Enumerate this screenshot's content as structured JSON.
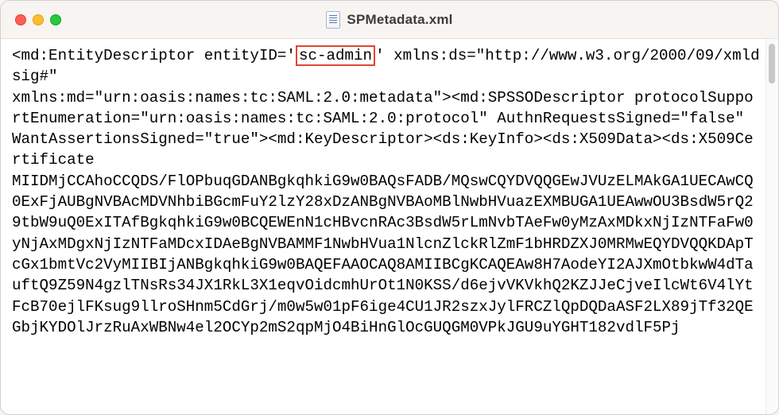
{
  "window": {
    "title": "SPMetadata.xml"
  },
  "highlight": {
    "entity_id": "sc-admin"
  },
  "xml": {
    "pre": "<md:EntityDescriptor entityID='",
    "post_entity": "' xmlns:ds=\"http://www.w3.org/2000/09/xmldsig#\"\nxmlns:md=\"urn:oasis:names:tc:SAML:2.0:metadata\"><md:SPSSODescriptor protocolSupportEnumeration=\"urn:oasis:names:tc:SAML:2.0:protocol\" AuthnRequestsSigned=\"false\"\nWantAssertionsSigned=\"true\"><md:KeyDescriptor><ds:KeyInfo><ds:X509Data><ds:X509Certificate\nMIIDMjCCAhoCCQDS/FlOPbuqGDANBgkqhkiG9w0BAQsFADB/MQswCQYDVQQGEwJVUzELMAkGA1UECAwCQ0ExFjAUBgNVBAcMDVNhbiBGcmFuY2lzY28xDzANBgNVBAoMBlNwbHVuazEXMBUGA1UEAwwOU3BsdW5rQ29tbW9uQ0ExITAfBgkqhkiG9w0BCQEWEnN1cHBvcnRAc3BsdW5rLmNvbTAeFw0yMzAxMDkxNjIzNTFaFw0yNjAxMDgxNjIzNTFaMDcxIDAeBgNVBAMMF1NwbHVua1NlcnZlckRlZmF1bHRDZXJ0MRMwEQYDVQQKDApTcGx1bmtVc2VyMIIBIjANBgkqhkiG9w0BAQEFAAOCAQ8AMIIBCgKCAQEAw8H7AodeYI2AJXmOtbkwW4dTauftQ9Z59N4gzlTNsRs34JX1RkL3X1eqvOidcmhUrOt1N0KSS/d6ejvVKVkhQ2KZJJeCjveIlcWt6V4lYtFcB70ejlFKsug9llroSHnm5CdGrj/m0w5w01pF6ige4CU1JR2szxJylFRCZlQpDQDaASF2LX89jTf32QEGbjKYDOlJrzRuAxWBNw4el2OCYp2mS2qpMjO4BiHnGlOcGUQGM0VPkJGU9uYGHT182vdlF5Pj"
  }
}
